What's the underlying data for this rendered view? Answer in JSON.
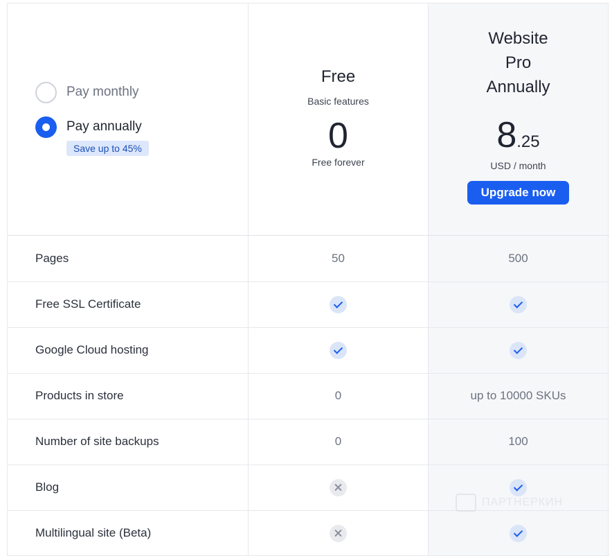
{
  "billing": {
    "options": [
      {
        "label": "Pay monthly",
        "selected": false
      },
      {
        "label": "Pay annually",
        "selected": true
      }
    ],
    "save_badge": "Save up to 45%"
  },
  "plans": {
    "free": {
      "name": "Free",
      "subtitle": "Basic features",
      "price": "0",
      "price_note": "Free forever"
    },
    "pro": {
      "name_lines": [
        "Website",
        "Pro",
        "Annually"
      ],
      "price_main": "8",
      "price_cents": ".25",
      "price_note": "USD / month",
      "button_label": "Upgrade now"
    }
  },
  "features": [
    {
      "name": "Pages",
      "free": "50",
      "pro": "500"
    },
    {
      "name": "Free SSL Certificate",
      "free": "check",
      "pro": "check"
    },
    {
      "name": "Google Cloud hosting",
      "free": "check",
      "pro": "check"
    },
    {
      "name": "Products in store",
      "free": "0",
      "pro": "up to 10000 SKUs"
    },
    {
      "name": "Number of site backups",
      "free": "0",
      "pro": "100"
    },
    {
      "name": "Blog",
      "free": "cross",
      "pro": "check"
    },
    {
      "name": "Multilingual site (Beta)",
      "free": "cross",
      "pro": "check"
    }
  ],
  "watermark": {
    "text": "ПАРТНЕРКИН"
  },
  "colors": {
    "accent": "#1a5ef0",
    "pro_column_bg": "#f6f7f9",
    "badge_bg": "#dde7fb"
  }
}
